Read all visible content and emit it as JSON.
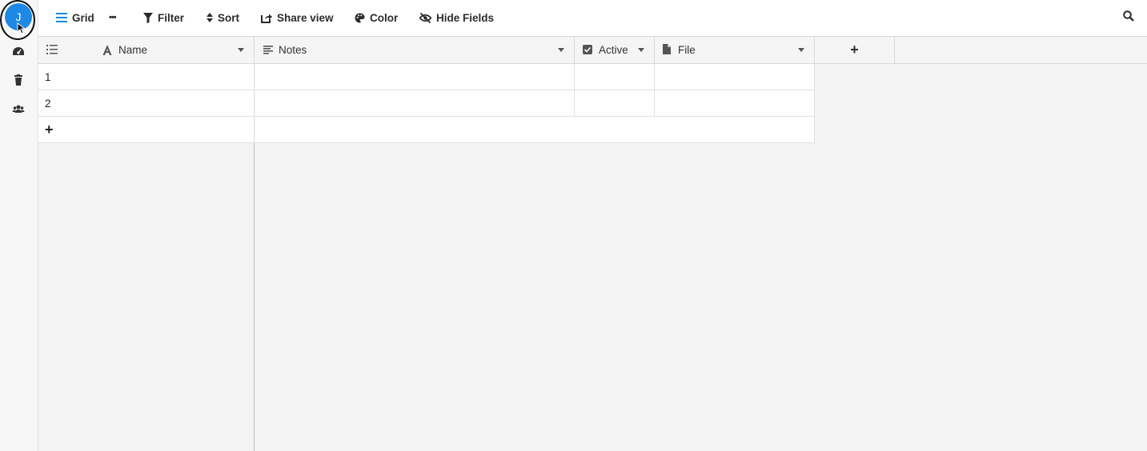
{
  "sidebar": {
    "avatar_initial": "J",
    "items": [
      {
        "name": "dashboard-icon"
      },
      {
        "name": "trash-icon"
      },
      {
        "name": "users-icon"
      }
    ]
  },
  "toolbar": {
    "grid_label": "Grid",
    "more_label": "•••",
    "filter_label": "Filter",
    "sort_label": "Sort",
    "share_label": "Share view",
    "color_label": "Color",
    "hide_label": "Hide Fields"
  },
  "table": {
    "columns": [
      {
        "label": "Name",
        "icon": "text-icon"
      },
      {
        "label": "Notes",
        "icon": "long-text-icon"
      },
      {
        "label": "Active",
        "icon": "checkbox-icon"
      },
      {
        "label": "File",
        "icon": "file-icon"
      }
    ],
    "rows": [
      {
        "index": "1",
        "name": "",
        "notes": "",
        "active": "",
        "file": ""
      },
      {
        "index": "2",
        "name": "",
        "notes": "",
        "active": "",
        "file": ""
      }
    ],
    "add_row": "+",
    "add_column": "+"
  },
  "colors": {
    "accent": "#1e88e5",
    "background": "#f3f3f3",
    "border": "#d9d9d9"
  }
}
